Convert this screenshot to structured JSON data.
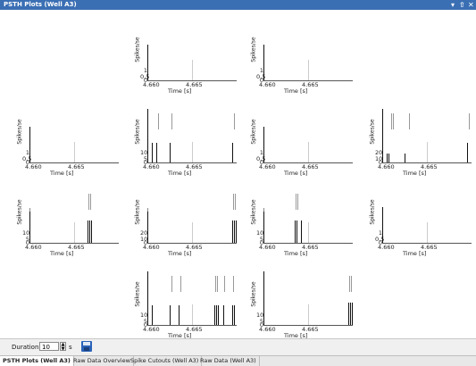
{
  "window": {
    "title": "PSTH Plots (Well A3)",
    "controls": [
      "▾",
      "⇧",
      "✕"
    ]
  },
  "plot_common": {
    "ylabel": "Spikes/se",
    "xlabel": "Time [s]",
    "xtick_left": "4.660",
    "xtick_mid": "4.665"
  },
  "plots": [
    {
      "id": "r0c1",
      "yticks": [
        "1",
        "0,5",
        "0"
      ],
      "spikes": [
        {
          "x": 4.66,
          "h": 40
        }
      ]
    },
    {
      "id": "r0c2",
      "yticks": [
        "1",
        "0,5",
        "0"
      ],
      "spikes": [
        {
          "x": 4.66,
          "h": 40
        }
      ]
    },
    {
      "id": "r1c0",
      "yticks": [
        "1",
        "0,5",
        "0"
      ],
      "spikes": [
        {
          "x": 4.66,
          "h": 40
        }
      ]
    },
    {
      "id": "r1c1",
      "yticks": [
        "10",
        "5",
        "0"
      ],
      "spikes": [
        {
          "x": 4.66,
          "h": 60
        },
        {
          "x": 4.6605,
          "h": 22
        },
        {
          "x": 4.661,
          "h": 22
        },
        {
          "x": 4.6612,
          "h": 22,
          "gray": true
        },
        {
          "x": 4.6625,
          "h": 22
        },
        {
          "x": 4.6627,
          "h": 22,
          "gray": true
        },
        {
          "x": 4.6695,
          "h": 22
        },
        {
          "x": 4.6697,
          "h": 22,
          "gray": true
        }
      ]
    },
    {
      "id": "r1c2",
      "yticks": [
        "1",
        "0,5",
        "0"
      ],
      "spikes": [
        {
          "x": 4.66,
          "h": 40
        }
      ]
    },
    {
      "id": "r1c3",
      "yticks": [
        "20",
        "10",
        "0"
      ],
      "spikes": [
        {
          "x": 4.66,
          "h": 60
        },
        {
          "x": 4.6605,
          "h": 10
        },
        {
          "x": 4.6607,
          "h": 10
        },
        {
          "x": 4.661,
          "h": 22,
          "gray": true
        },
        {
          "x": 4.6612,
          "h": 22,
          "gray": true
        },
        {
          "x": 4.6625,
          "h": 10
        },
        {
          "x": 4.663,
          "h": 22,
          "gray": true
        },
        {
          "x": 4.6695,
          "h": 22
        },
        {
          "x": 4.6697,
          "h": 22,
          "gray": true
        }
      ]
    },
    {
      "id": "r2c0",
      "yticks": [
        "10",
        "5",
        "0"
      ],
      "spikes": [
        {
          "x": 4.66,
          "h": 35
        },
        {
          "x": 4.6665,
          "h": 25
        },
        {
          "x": 4.6667,
          "h": 25
        },
        {
          "x": 4.6669,
          "h": 25
        },
        {
          "x": 4.6666,
          "h": 22,
          "gray": true
        },
        {
          "x": 4.6668,
          "h": 22,
          "gray": true
        }
      ]
    },
    {
      "id": "r2c1",
      "yticks": [
        "20",
        "10",
        "0"
      ],
      "spikes": [
        {
          "x": 4.66,
          "h": 35
        },
        {
          "x": 4.6695,
          "h": 25
        },
        {
          "x": 4.6697,
          "h": 25
        },
        {
          "x": 4.6699,
          "h": 25
        },
        {
          "x": 4.6696,
          "h": 22,
          "gray": true
        },
        {
          "x": 4.6698,
          "h": 22,
          "gray": true
        }
      ]
    },
    {
      "id": "r2c2",
      "yticks": [
        "10",
        "5",
        "0"
      ],
      "spikes": [
        {
          "x": 4.66,
          "h": 35
        },
        {
          "x": 4.6635,
          "h": 25
        },
        {
          "x": 4.6637,
          "h": 25
        },
        {
          "x": 4.6642,
          "h": 25
        },
        {
          "x": 4.6636,
          "h": 22,
          "gray": true
        },
        {
          "x": 4.6638,
          "h": 22,
          "gray": true
        }
      ]
    },
    {
      "id": "r2c3",
      "yticks": [
        "1",
        "0,5",
        "0"
      ],
      "spikes": [
        {
          "x": 4.66,
          "h": 40
        }
      ]
    },
    {
      "id": "r3c1",
      "yticks": [
        "10",
        "5",
        "0"
      ],
      "spikes": [
        {
          "x": 4.66,
          "h": 60
        },
        {
          "x": 4.6605,
          "h": 22
        },
        {
          "x": 4.6625,
          "h": 22
        },
        {
          "x": 4.6627,
          "h": 22,
          "gray": true
        },
        {
          "x": 4.6635,
          "h": 22
        },
        {
          "x": 4.6637,
          "h": 22,
          "gray": true
        },
        {
          "x": 4.6675,
          "h": 22
        },
        {
          "x": 4.6677,
          "h": 22
        },
        {
          "x": 4.6679,
          "h": 22
        },
        {
          "x": 4.6676,
          "h": 22,
          "gray": true
        },
        {
          "x": 4.6678,
          "h": 22,
          "gray": true
        },
        {
          "x": 4.6685,
          "h": 22
        },
        {
          "x": 4.6686,
          "h": 22,
          "gray": true
        },
        {
          "x": 4.6695,
          "h": 22
        },
        {
          "x": 4.6697,
          "h": 22
        },
        {
          "x": 4.6696,
          "h": 22,
          "gray": true
        }
      ]
    },
    {
      "id": "r3c2",
      "yticks": [
        "10",
        "5",
        "0"
      ],
      "spikes": [
        {
          "x": 4.66,
          "h": 60
        },
        {
          "x": 4.6695,
          "h": 25
        },
        {
          "x": 4.6697,
          "h": 25
        },
        {
          "x": 4.6699,
          "h": 25
        },
        {
          "x": 4.6696,
          "h": 22,
          "gray": true
        },
        {
          "x": 4.6698,
          "h": 22,
          "gray": true
        }
      ]
    }
  ],
  "bottom": {
    "duration_label": "Duration:",
    "duration_value": "10",
    "duration_unit": "s"
  },
  "tabs": [
    "PSTH Plots (Well A3)",
    "Raw Data Overview",
    "Spike Cutouts (Well A3)",
    "Raw Data (Well A3)"
  ]
}
